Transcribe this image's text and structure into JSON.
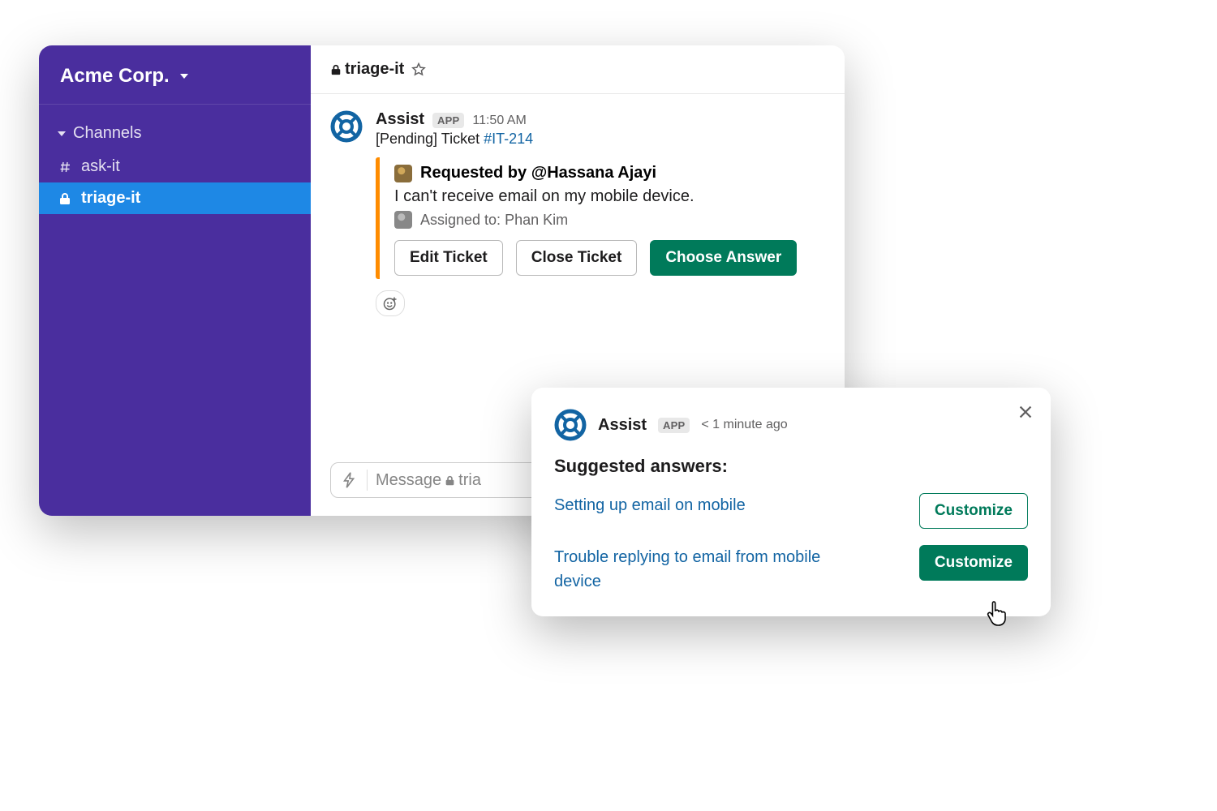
{
  "workspace": {
    "name": "Acme Corp."
  },
  "sidebar": {
    "section_label": "Channels",
    "channels": [
      {
        "name": "ask-it",
        "icon": "hash",
        "active": false
      },
      {
        "name": "triage-it",
        "icon": "lock",
        "active": true
      }
    ]
  },
  "channel_header": {
    "name": "triage-it",
    "locked": true
  },
  "message": {
    "author": "Assist",
    "badge": "APP",
    "time": "11:50 AM",
    "status_prefix": "[Pending] Ticket ",
    "ticket_id": "#IT-214",
    "attachment": {
      "requested_by_label": "Requested by ",
      "requested_by_user": "@Hassana Ajayi",
      "body": "I can't receive email on my mobile device.",
      "assigned_label": "Assigned to: ",
      "assigned_user": "Phan Kim"
    },
    "buttons": {
      "edit": "Edit Ticket",
      "close": "Close Ticket",
      "choose": "Choose Answer"
    }
  },
  "composer": {
    "placeholder_prefix": "Message ",
    "placeholder_channel": "tria"
  },
  "popup": {
    "author": "Assist",
    "badge": "APP",
    "time": "< 1 minute ago",
    "title": "Suggested answers:",
    "answers": [
      {
        "text": "Setting up email on mobile",
        "button": "Customize"
      },
      {
        "text": "Trouble replying to email from mobile device",
        "button": "Customize"
      }
    ]
  }
}
